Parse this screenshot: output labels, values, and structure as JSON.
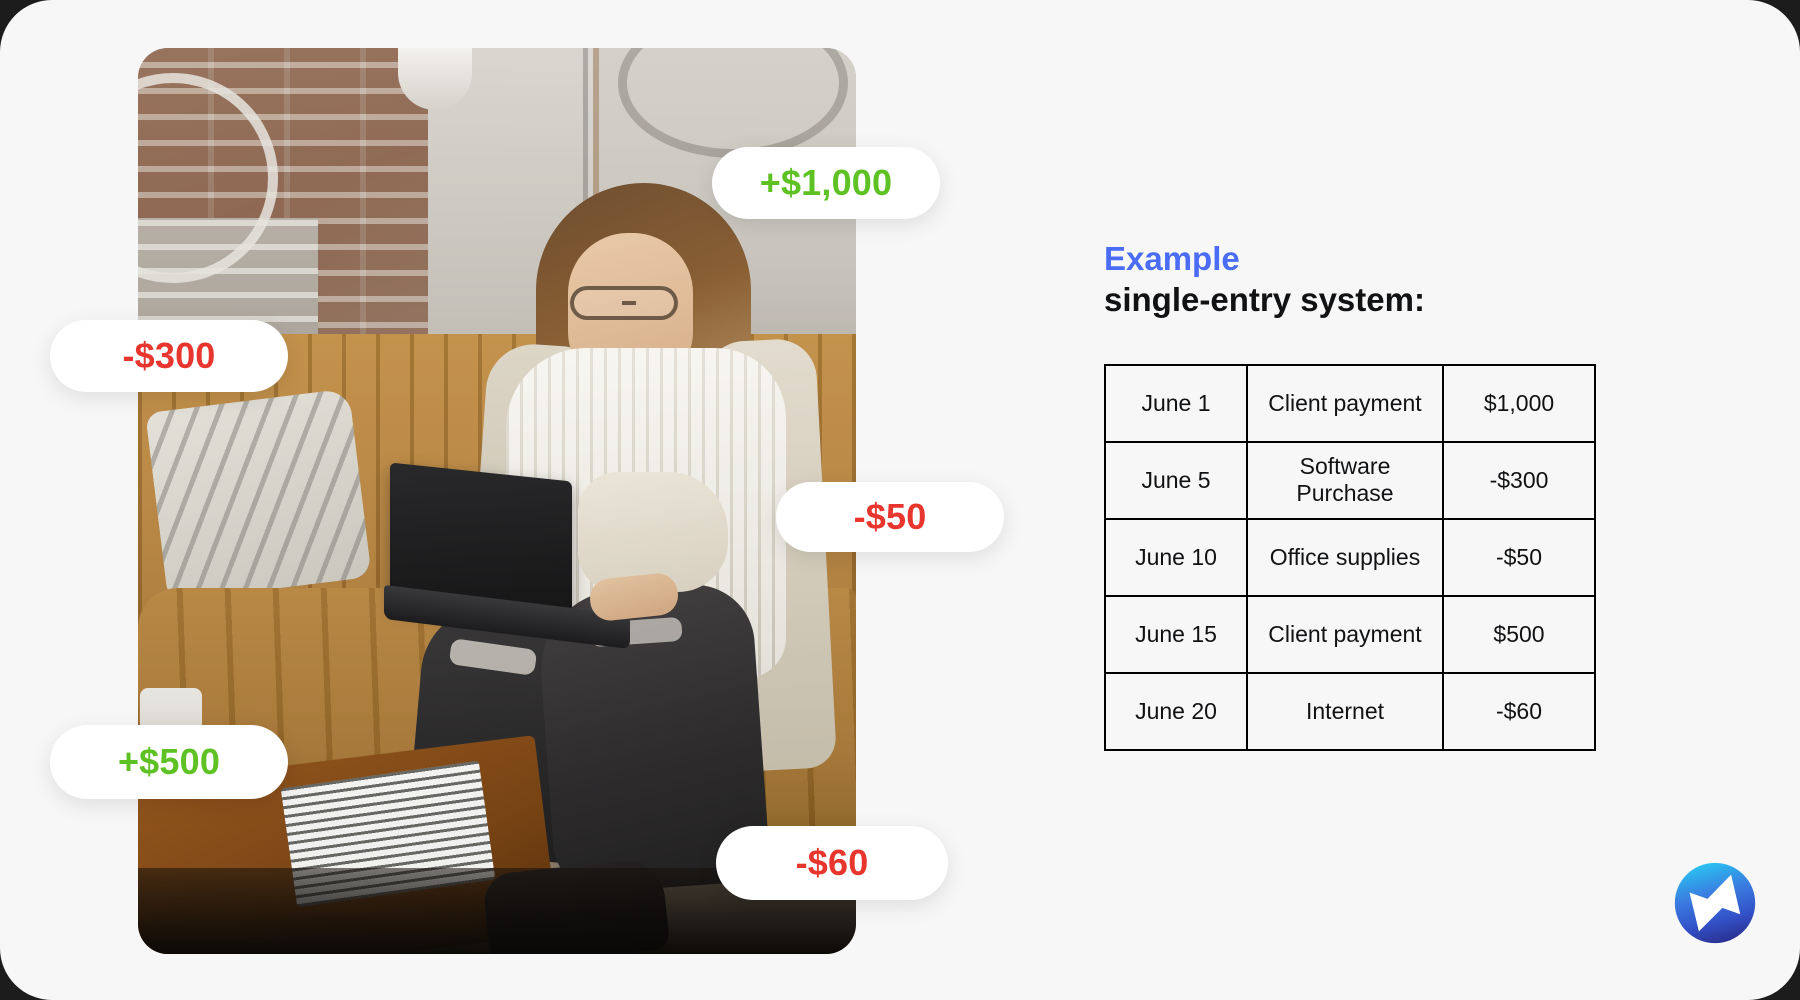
{
  "colors": {
    "background": "#f7f7f7",
    "accent_blue": "#4a6cf7",
    "positive_green": "#5ec224",
    "negative_red": "#e8352e",
    "table_border": "#000000",
    "text": "#111214"
  },
  "photo": {
    "alt_description": "Woman with glasses sitting on a mustard-yellow couch working on a black laptop in a brick-and-plaster loft"
  },
  "badges": [
    {
      "id": "badge-plus-1000",
      "label": "+$1,000",
      "sign": "positive"
    },
    {
      "id": "badge-minus-300",
      "label": "-$300",
      "sign": "negative"
    },
    {
      "id": "badge-minus-50",
      "label": "-$50",
      "sign": "negative"
    },
    {
      "id": "badge-plus-500",
      "label": "+$500",
      "sign": "positive"
    },
    {
      "id": "badge-minus-60",
      "label": "-$60",
      "sign": "negative"
    }
  ],
  "heading": {
    "kicker": "Example",
    "title": "single-entry system:"
  },
  "ledger": {
    "rows": [
      {
        "date": "June 1",
        "description": "Client payment",
        "amount": "$1,000"
      },
      {
        "date": "June 5",
        "description": "Software Purchase",
        "amount": "-$300"
      },
      {
        "date": "June 10",
        "description": "Office supplies",
        "amount": "-$50"
      },
      {
        "date": "June 15",
        "description": "Client payment",
        "amount": "$500"
      },
      {
        "date": "June 20",
        "description": "Internet",
        "amount": "-$60"
      }
    ]
  },
  "logo": {
    "name": "lightning-bolt-circle-logo",
    "gradient_from": "#29c4f2",
    "gradient_to": "#2a2f8f"
  }
}
